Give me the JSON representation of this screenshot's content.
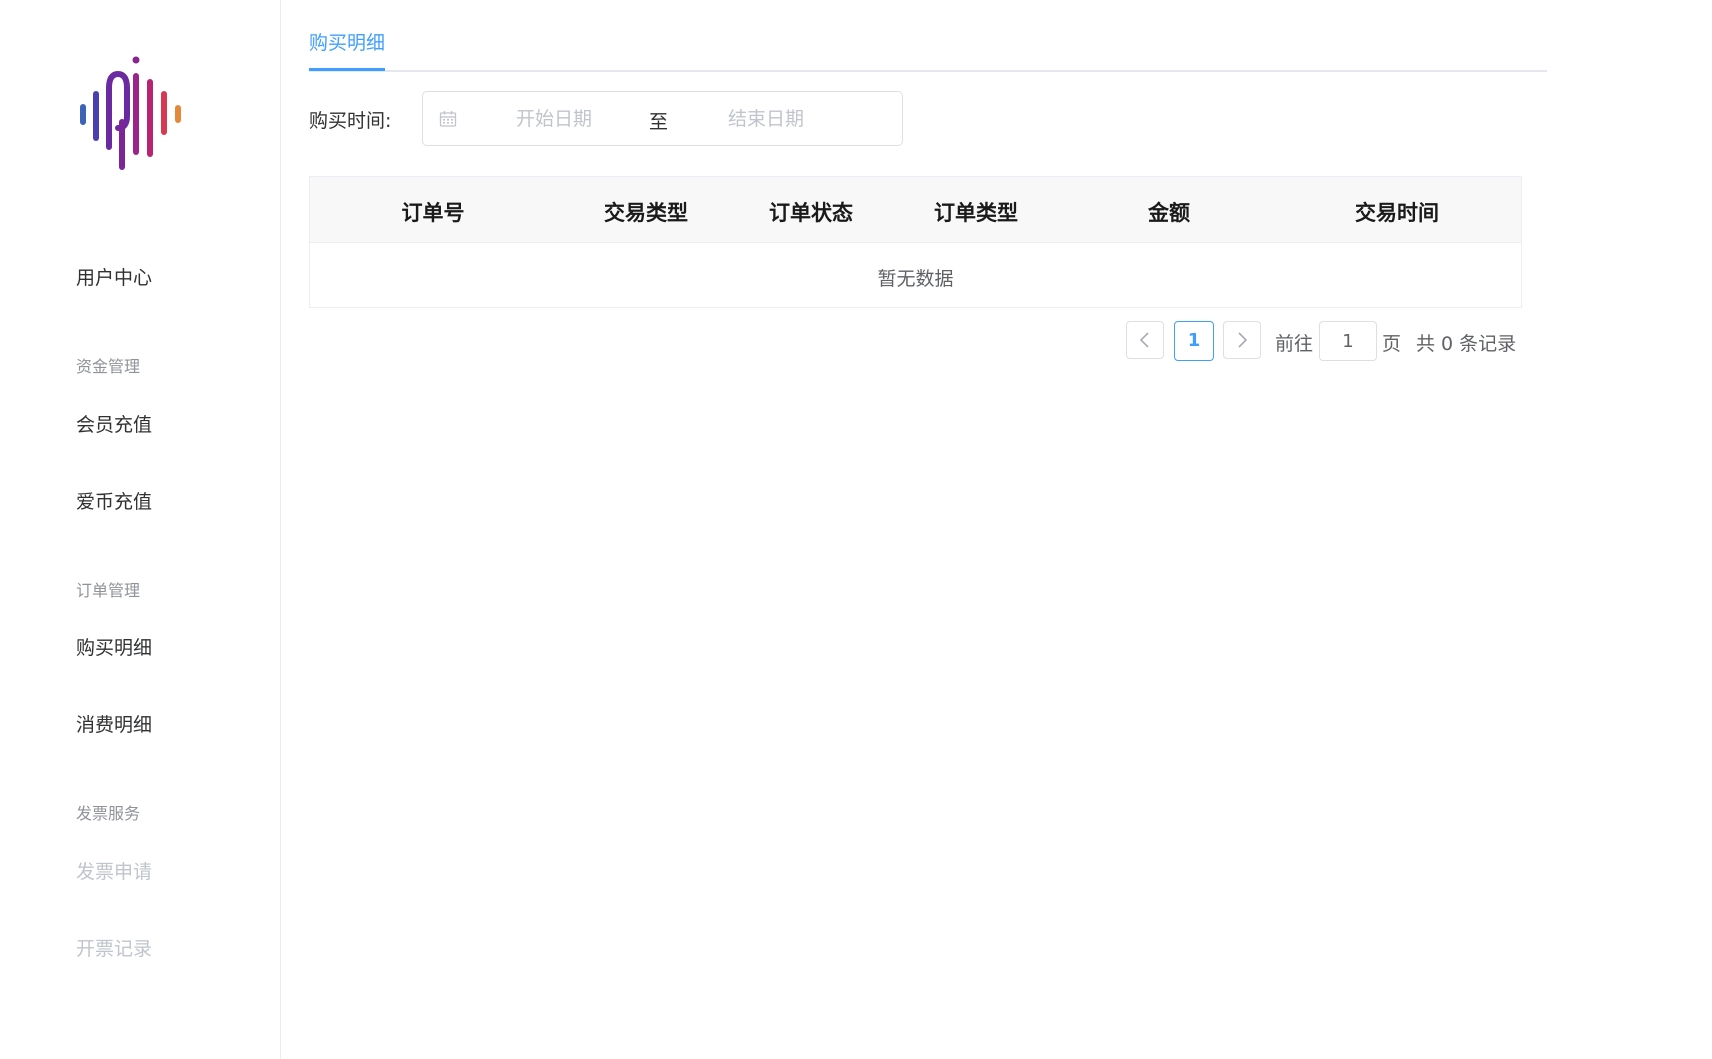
{
  "sidebar": {
    "logo_icon": "sound-wave-logo",
    "items": [
      {
        "type": "item",
        "label": "用户中心",
        "disabled": false
      },
      {
        "type": "group",
        "label": "资金管理"
      },
      {
        "type": "item",
        "label": "会员充值",
        "disabled": false
      },
      {
        "type": "item",
        "label": "爱币充值",
        "disabled": false
      },
      {
        "type": "group",
        "label": "订单管理"
      },
      {
        "type": "item",
        "label": "购买明细",
        "disabled": false
      },
      {
        "type": "item",
        "label": "消费明细",
        "disabled": false
      },
      {
        "type": "group",
        "label": "发票服务"
      },
      {
        "type": "item",
        "label": "发票申请",
        "disabled": true
      },
      {
        "type": "item",
        "label": "开票记录",
        "disabled": true
      }
    ]
  },
  "main": {
    "tab": {
      "label": "购买明细"
    },
    "filter": {
      "label": "购买时间:",
      "calendar_icon": "calendar-icon",
      "start_placeholder": "开始日期",
      "separator": "至",
      "end_placeholder": "结束日期",
      "start_value": "",
      "end_value": ""
    },
    "table": {
      "columns": [
        "订单号",
        "交易类型",
        "订单状态",
        "订单类型",
        "金额",
        "交易时间"
      ],
      "rows": [],
      "empty_text": "暂无数据"
    },
    "pagination": {
      "prev_icon": "chevron-left-icon",
      "next_icon": "chevron-right-icon",
      "current_page": "1",
      "goto_label": "前往",
      "goto_value": "1",
      "page_label": "页",
      "total_text": "共 0 条记录"
    }
  },
  "colors": {
    "accent": "#409eff",
    "border": "#dcdfe6",
    "header_bg": "#f8f8f8",
    "text": "#303133",
    "muted": "#909399",
    "disabled": "#c0c4cc"
  }
}
